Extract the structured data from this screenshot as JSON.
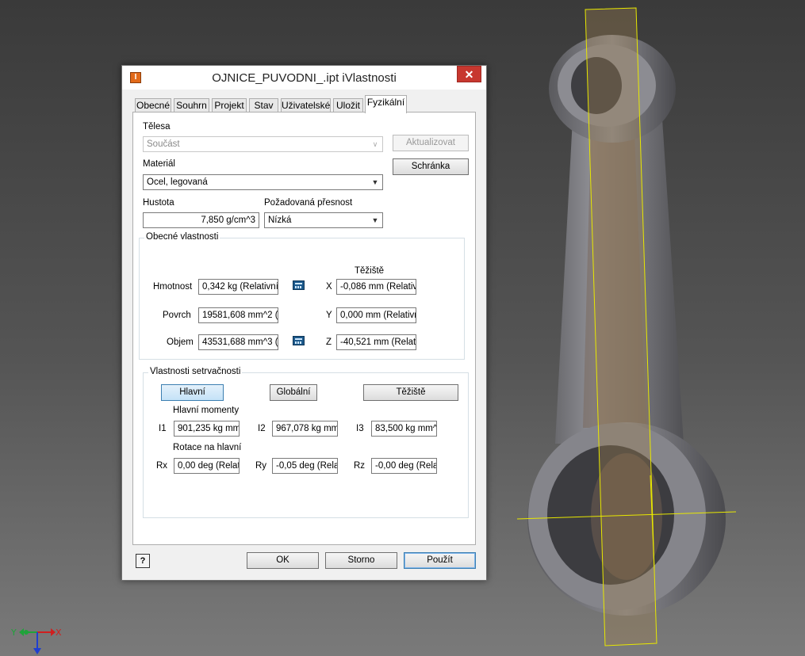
{
  "dialog": {
    "title": "OJNICE_PUVODNI_.ipt iVlastnosti",
    "close_glyph": "✕",
    "app_icon_letter": "I",
    "tabs": [
      {
        "label": "Obecné"
      },
      {
        "label": "Souhrn"
      },
      {
        "label": "Projekt"
      },
      {
        "label": "Stav"
      },
      {
        "label": "Uživatelské"
      },
      {
        "label": "Uložit"
      },
      {
        "label": "Fyzikální"
      }
    ],
    "active_tab": "Fyzikální"
  },
  "physical": {
    "bodies_label": "Tělesa",
    "bodies_value": "Součást",
    "update_button": "Aktualizovat",
    "clipboard_button": "Schránka",
    "material_label": "Materiál",
    "material_value": "Ocel, legovaná",
    "density_label": "Hustota",
    "density_value": "7,850 g/cm^3",
    "accuracy_label": "Požadovaná přesnost",
    "accuracy_value": "Nízká"
  },
  "general": {
    "group_title": "Obecné vlastnosti",
    "centroid_title": "Těžiště",
    "mass_label": "Hmotnost",
    "mass_value": "0,342 kg (Relativní",
    "area_label": "Povrch",
    "area_value": "19581,608 mm^2 (",
    "volume_label": "Objem",
    "volume_value": "43531,688 mm^3 (",
    "x_label": "X",
    "x_value": "-0,086 mm (Relativ",
    "y_label": "Y",
    "y_value": "0,000 mm (Relativn",
    "z_label": "Z",
    "z_value": "-40,521 mm (Relati"
  },
  "inertia": {
    "group_title": "Vlastnosti setrvačnosti",
    "principal_button": "Hlavní",
    "global_button": "Globální",
    "centroid_button": "Těžiště",
    "moments_title": "Hlavní momenty",
    "i1_label": "I1",
    "i1_value": "901,235 kg mm",
    "i2_label": "I2",
    "i2_value": "967,078 kg mm",
    "i3_label": "I3",
    "i3_value": "83,500 kg mm^",
    "rotation_title": "Rotace na hlavní",
    "rx_label": "Rx",
    "rx_value": "0,00 deg (Relat",
    "ry_label": "Ry",
    "ry_value": "-0,05 deg (Rela",
    "rz_label": "Rz",
    "rz_value": "-0,00 deg (Rela"
  },
  "footer": {
    "help_glyph": "?",
    "ok": "OK",
    "cancel": "Storno",
    "apply": "Použít"
  },
  "viewport": {
    "triad_x_label": "X",
    "triad_y_label": "Y",
    "triad_colors": {
      "x": "#d01f1f",
      "y": "#1fa33a",
      "z": "#1f3fd0"
    }
  }
}
